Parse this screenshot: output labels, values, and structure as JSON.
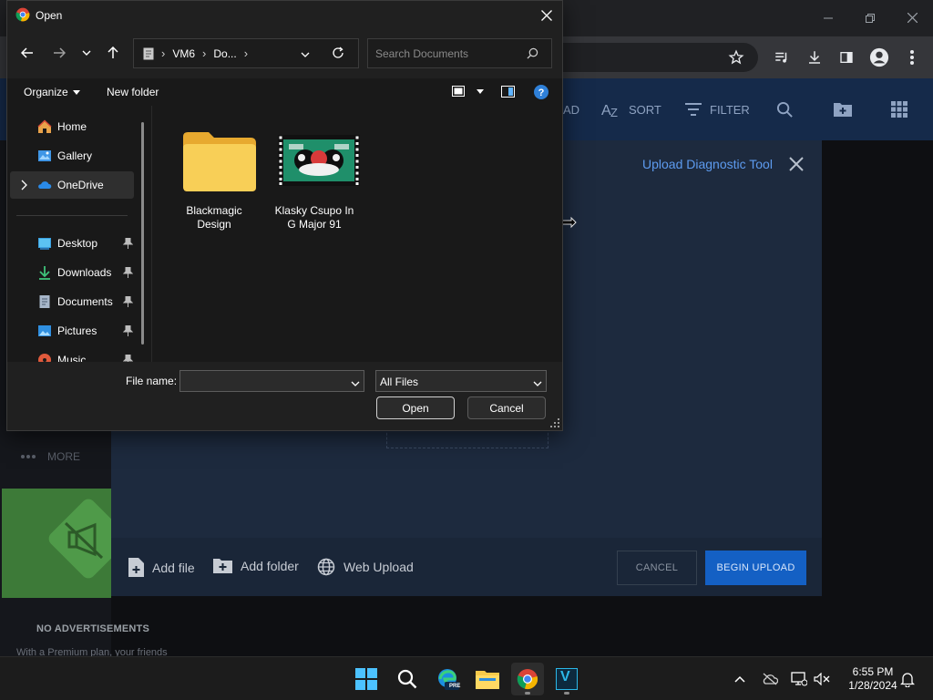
{
  "dialog": {
    "title": "Open",
    "breadcrumb": [
      "VM6",
      "Do..."
    ],
    "search_placeholder": "Search Documents",
    "commands": {
      "organize": "Organize",
      "new_folder": "New folder"
    },
    "nav_items": [
      {
        "label": "Home",
        "icon": "home-icon"
      },
      {
        "label": "Gallery",
        "icon": "gallery-icon"
      },
      {
        "label": "OneDrive",
        "icon": "onedrive-icon",
        "selected": true
      },
      {
        "label": "Desktop",
        "icon": "desktop-icon",
        "pinned": true
      },
      {
        "label": "Downloads",
        "icon": "downloads-icon",
        "pinned": true
      },
      {
        "label": "Documents",
        "icon": "documents-icon",
        "pinned": true
      },
      {
        "label": "Pictures",
        "icon": "pictures-icon",
        "pinned": true
      },
      {
        "label": "Music",
        "icon": "music-icon",
        "pinned": true
      }
    ],
    "files": [
      {
        "line1": "Blackmagic",
        "line2": "Design",
        "kind": "folder"
      },
      {
        "line1": "Klasky Csupo In",
        "line2": "G Major 91",
        "kind": "video"
      }
    ],
    "file_name_label": "File name:",
    "file_name_value": "",
    "file_type": "All Files",
    "open_label": "Open",
    "cancel_label": "Cancel"
  },
  "site": {
    "toolbar": {
      "partial": "AD",
      "sort": "SORT",
      "filter": "FILTER"
    },
    "more_label": "MORE",
    "no_ads": "NO ADVERTISEMENTS",
    "premium_text": "With a Premium plan, your friends",
    "upload": {
      "diagnostic_link": "Upload Diagnostic Tool",
      "add_file": "Add file",
      "add_folder": "Add folder",
      "web_upload": "Web Upload",
      "cancel": "CANCEL",
      "begin": "BEGIN UPLOAD"
    }
  },
  "taskbar": {
    "time": "6:55 PM",
    "date": "1/28/2024",
    "edge_badge": "PRE",
    "app_v_letter": "V"
  },
  "colors": {
    "accent_blue": "#1460c4",
    "link_blue": "#5d9bef",
    "folder_yellow": "#f6c94a",
    "dialog_bg": "#191919"
  }
}
